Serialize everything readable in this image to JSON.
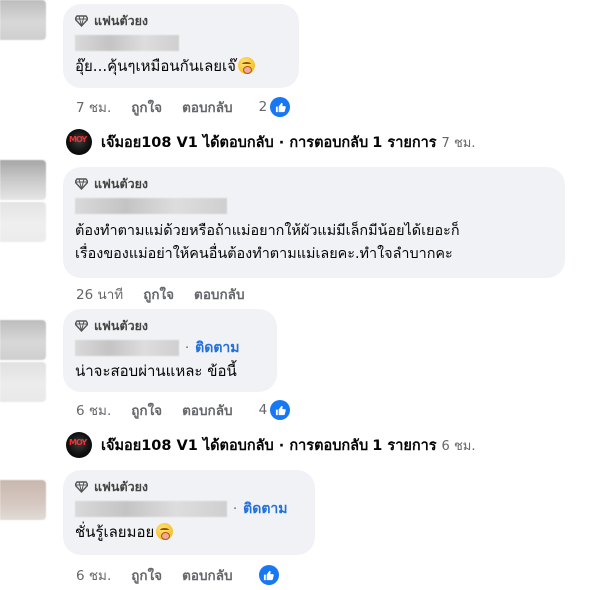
{
  "badge_label": "แฟนตัวยง",
  "comments": [
    {
      "text": "อุ๊ย...คุ้นๆเหมือนกันเลยเจ๊",
      "emoji": "astonished-face-icon",
      "time": "7 ชม.",
      "like_label": "ถูกใจ",
      "reply_label": "ตอบกลับ",
      "reaction_count": "2",
      "follow_label": ""
    },
    {
      "text_lines": [
        "ต้องทำตามแม่ด้วยหรือถ้าแม่อยากให้ผัวแม่มีเล็กมีน้อยได้เยอะก็",
        "เรื่องของแม่อย่าให้คนอื่นต้องทำตามแม่เลยคะ.ทำใจลำบากคะ"
      ],
      "time": "26 นาที",
      "like_label": "ถูกใจ",
      "reply_label": "ตอบกลับ"
    },
    {
      "text": "น่าจะสอบผ่านแหละ ข้อนี้",
      "time": "6 ชม.",
      "like_label": "ถูกใจ",
      "reply_label": "ตอบกลับ",
      "reaction_count": "4",
      "follow_label": "ติดตาม"
    },
    {
      "text": "ชั่นรู้เลยมอย",
      "emoji": "astonished-face-icon",
      "time": "6 ชม.",
      "like_label": "ถูกใจ",
      "reply_label": "ตอบกลับ",
      "follow_label": "ติดตาม"
    }
  ],
  "replies": [
    {
      "name": "เจ๊มอย108 V1",
      "action": "ได้ตอบกลับ · การตอบกลับ",
      "count": "1 รายการ",
      "time": "7 ชม."
    },
    {
      "name": "เจ๊มอย108 V1",
      "action": "ได้ตอบกลับ · การตอบกลับ",
      "count": "1 รายการ",
      "time": "6 ชม."
    }
  ],
  "colors": {
    "bubble": "#f0f2f5",
    "link": "#216fdb",
    "like": "#1877f2",
    "muted": "#65676b"
  }
}
